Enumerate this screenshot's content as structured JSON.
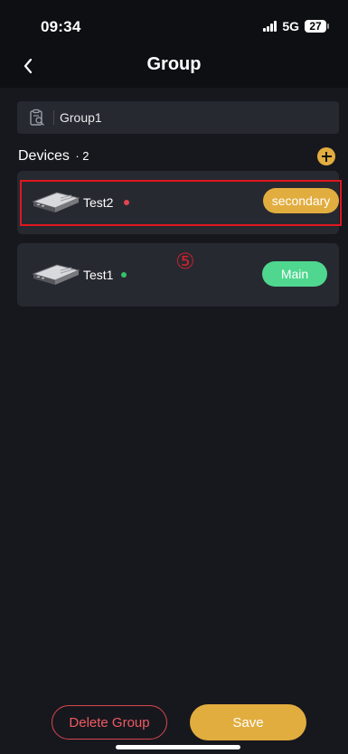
{
  "status_bar": {
    "time": "09:34",
    "network": "5G",
    "battery": "27"
  },
  "header": {
    "title": "Group"
  },
  "group": {
    "name": "Group1"
  },
  "devices": {
    "label": "Devices",
    "count": "· 2",
    "items": [
      {
        "name": "Test2",
        "status": "offline",
        "role": "secondary"
      },
      {
        "name": "Test1",
        "status": "online",
        "role": "Main"
      }
    ]
  },
  "annotation": "⑤",
  "actions": {
    "delete_label": "Delete Group",
    "save_label": "Save"
  },
  "colors": {
    "accent": "#e2ad3f",
    "main_role": "#4fd78f",
    "danger": "#ef5a61",
    "online": "#34c26a",
    "offline": "#e2464d"
  }
}
